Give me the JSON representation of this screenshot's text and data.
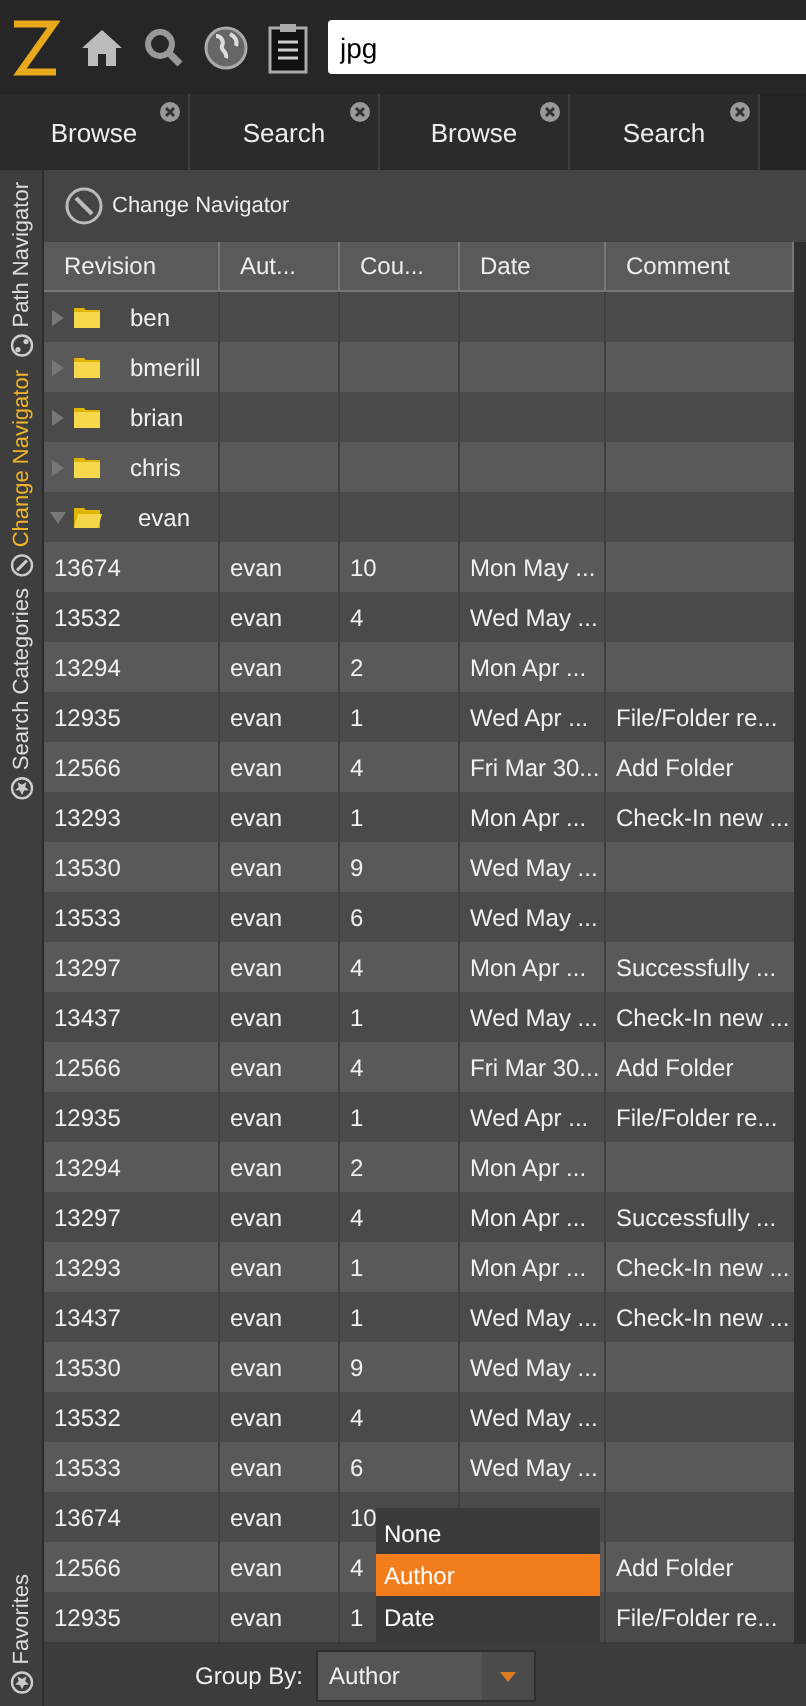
{
  "search": {
    "value": "jpg"
  },
  "tabs": [
    {
      "label": "Browse",
      "selected": false
    },
    {
      "label": "Search",
      "selected": false
    },
    {
      "label": "Browse",
      "selected": false
    },
    {
      "label": "Search",
      "selected": false
    }
  ],
  "sidebar": {
    "items": [
      {
        "label": "Path Navigator",
        "selected": false
      },
      {
        "label": "Change Navigator",
        "selected": true
      },
      {
        "label": "Search Categories",
        "selected": false
      }
    ],
    "bottom_item": {
      "label": "Favorites",
      "selected": false
    }
  },
  "panel_title": "Change Navigator",
  "table": {
    "columns": [
      "Revision",
      "Aut...",
      "Cou...",
      "Date",
      "Comment"
    ],
    "groups": [
      {
        "name": "ben",
        "expanded": false
      },
      {
        "name": "bmerill",
        "expanded": false
      },
      {
        "name": "brian",
        "expanded": false
      },
      {
        "name": "chris",
        "expanded": false
      },
      {
        "name": "evan",
        "expanded": true
      }
    ],
    "rows": [
      [
        "13674",
        "evan",
        "10",
        "Mon May ...",
        ""
      ],
      [
        "13532",
        "evan",
        "4",
        "Wed May ...",
        ""
      ],
      [
        "13294",
        "evan",
        "2",
        "Mon Apr ...",
        ""
      ],
      [
        "12935",
        "evan",
        "1",
        "Wed Apr ...",
        "File/Folder re..."
      ],
      [
        "12566",
        "evan",
        "4",
        "Fri Mar 30...",
        "Add Folder"
      ],
      [
        "13293",
        "evan",
        "1",
        "Mon Apr ...",
        "Check-In new ..."
      ],
      [
        "13530",
        "evan",
        "9",
        "Wed May ...",
        ""
      ],
      [
        "13533",
        "evan",
        "6",
        "Wed May ...",
        ""
      ],
      [
        "13297",
        "evan",
        "4",
        "Mon Apr ...",
        "Successfully ..."
      ],
      [
        "13437",
        "evan",
        "1",
        "Wed May ...",
        "Check-In new ..."
      ],
      [
        "12566",
        "evan",
        "4",
        "Fri Mar 30...",
        "Add Folder"
      ],
      [
        "12935",
        "evan",
        "1",
        "Wed Apr ...",
        "File/Folder re..."
      ],
      [
        "13294",
        "evan",
        "2",
        "Mon Apr ...",
        ""
      ],
      [
        "13297",
        "evan",
        "4",
        "Mon Apr ...",
        "Successfully ..."
      ],
      [
        "13293",
        "evan",
        "1",
        "Mon Apr ...",
        "Check-In new ..."
      ],
      [
        "13437",
        "evan",
        "1",
        "Wed May ...",
        "Check-In new ..."
      ],
      [
        "13530",
        "evan",
        "9",
        "Wed May ...",
        ""
      ],
      [
        "13532",
        "evan",
        "4",
        "Wed May ...",
        ""
      ],
      [
        "13533",
        "evan",
        "6",
        "Wed May ...",
        ""
      ],
      [
        "13674",
        "evan",
        "10",
        "",
        ""
      ],
      [
        "12566",
        "evan",
        "4",
        "",
        "Add Folder"
      ],
      [
        "12935",
        "evan",
        "1",
        "",
        "File/Folder re..."
      ]
    ]
  },
  "group_by": {
    "label": "Group By:",
    "value": "Author",
    "expanded": true,
    "options": [
      {
        "label": "None",
        "selected": false
      },
      {
        "label": "Author",
        "selected": true
      },
      {
        "label": "Date",
        "selected": false
      }
    ]
  }
}
